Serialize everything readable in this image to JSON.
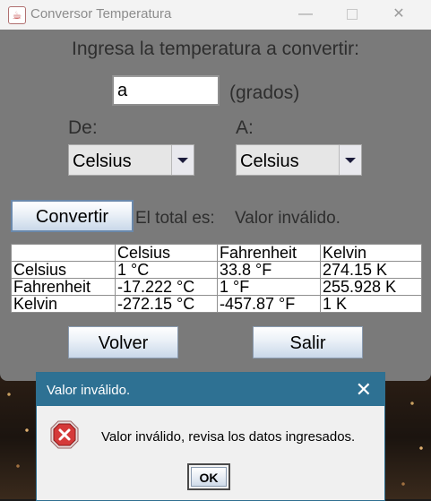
{
  "window": {
    "title": "Conversor Temperatura",
    "minimize_glyph": "—",
    "close_glyph": "✕"
  },
  "form": {
    "heading": "Ingresa la temperatura a convertir:",
    "input_value": "a",
    "units_label": "(grados)",
    "from_label": "De:",
    "to_label": "A:",
    "from_selected": "Celsius",
    "to_selected": "Celsius",
    "convert_label": "Convertir",
    "total_label": "El total es:",
    "total_value": "Valor inválido."
  },
  "table": {
    "headers": [
      "",
      "Celsius",
      "Fahrenheit",
      "Kelvin"
    ],
    "rows": [
      [
        "Celsius",
        "1 °C",
        "33.8 °F",
        "274.15 K"
      ],
      [
        "Fahrenheit",
        "-17.222 °C",
        "1 °F",
        "255.928 K"
      ],
      [
        "Kelvin",
        "-272.15 °C",
        "-457.87 °F",
        "1 K"
      ]
    ]
  },
  "buttons": {
    "back_label": "Volver",
    "exit_label": "Salir"
  },
  "dialog": {
    "title": "Valor inválido.",
    "message": "Valor inválido, revisa los datos ingresados.",
    "ok_label": "OK",
    "close_glyph": "✕",
    "icon": "error-icon"
  },
  "colors": {
    "window_bg": "#7a7a7a",
    "dialog_title_bg": "#2e7193",
    "error_red": "#d53a3a"
  }
}
